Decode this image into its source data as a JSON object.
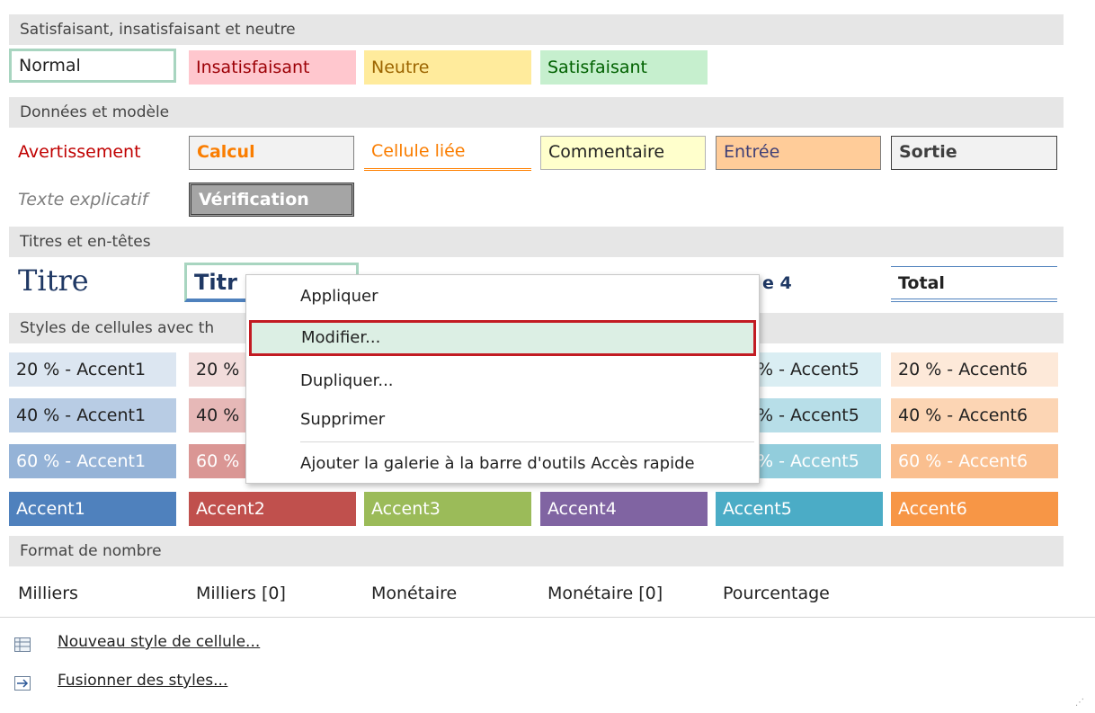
{
  "sections": {
    "s1": "Satisfaisant, insatisfaisant et neutre",
    "s2": "Données et modèle",
    "s3": "Titres et en-têtes",
    "s4": "Styles de cellules avec th",
    "s5": "Format de nombre"
  },
  "good_bad": [
    "Normal",
    "Insatisfaisant",
    "Neutre",
    "Satisfaisant"
  ],
  "data_model": [
    "Avertissement",
    "Calcul",
    "Cellule liée",
    "Commentaire",
    "Entrée",
    "Sortie",
    "Texte explicatif",
    "Vérification"
  ],
  "titles": [
    "Titre",
    "Titr",
    "e 4",
    "Total"
  ],
  "accents": {
    "row20": [
      "20 % - Accent1",
      "20 %",
      "% - Accent5",
      "20 % - Accent6"
    ],
    "row40": [
      "40 % - Accent1",
      "40 %",
      "% - Accent5",
      "40 % - Accent6"
    ],
    "row60": [
      "60 % - Accent1",
      "60 %",
      "% - Accent5",
      "60 % - Accent6"
    ],
    "solid": [
      "Accent1",
      "Accent2",
      "Accent3",
      "Accent4",
      "Accent5",
      "Accent6"
    ]
  },
  "number_format": [
    "Milliers",
    "Milliers [0]",
    "Monétaire",
    "Monétaire [0]",
    "Pourcentage"
  ],
  "context_menu": [
    {
      "label": "Appliquer",
      "highlighted": false
    },
    {
      "label": "Modifier...",
      "highlighted": true
    },
    {
      "label": "Dupliquer...",
      "highlighted": false
    },
    {
      "label": "Supprimer",
      "highlighted": false
    },
    {
      "label": "Ajouter la galerie à la barre d'outils Accès rapide",
      "highlighted": false
    }
  ],
  "bottom": {
    "new_style": "Nouveau style de cellule...",
    "merge_styles": "Fusionner des styles..."
  },
  "colors": {
    "accent1": "#4f81bd",
    "accent2": "#c0504d",
    "accent3": "#9bbb59",
    "accent4": "#8064a2",
    "accent5": "#4bacc6",
    "accent6": "#f79646",
    "menu_highlight": "#dcefe4",
    "menu_border": "#c21b22"
  }
}
